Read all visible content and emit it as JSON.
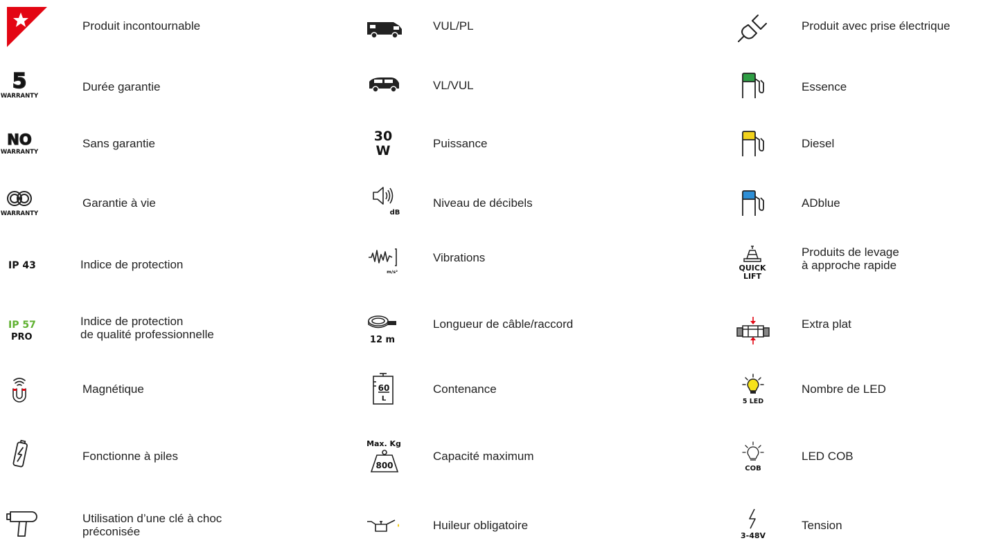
{
  "legend": {
    "col1": [
      {
        "icon": "star-flag-icon",
        "lines": [
          "Produit incontournable"
        ]
      },
      {
        "icon": "warranty-5-icon",
        "lines": [
          "Durée garantie"
        ],
        "badge": "5",
        "badge_sub": "WARRANTY"
      },
      {
        "icon": "no-warranty-icon",
        "lines": [
          "Sans garantie"
        ],
        "badge": "NO",
        "badge_sub": "WARRANTY"
      },
      {
        "icon": "lifetime-warranty-icon",
        "lines": [
          "Garantie à vie"
        ],
        "badge_sub": "WARRANTY"
      },
      {
        "icon": "ip43-icon",
        "lines": [
          "Indice de protection"
        ],
        "badge": "IP 43"
      },
      {
        "icon": "ip57-pro-icon",
        "lines": [
          "Indice de protection",
          "de qualité professionnelle"
        ],
        "badge": "IP 57",
        "badge_sub": "PRO"
      },
      {
        "icon": "magnet-icon",
        "lines": [
          "Magnétique"
        ]
      },
      {
        "icon": "battery-icon",
        "lines": [
          "Fonctionne à piles"
        ]
      },
      {
        "icon": "impact-wrench-icon",
        "lines": [
          "Utilisation d’une clé à choc",
          "préconisée"
        ]
      }
    ],
    "col2": [
      {
        "icon": "truck-icon",
        "lines": [
          "VUL/PL"
        ]
      },
      {
        "icon": "van-icon",
        "lines": [
          "VL/VUL"
        ]
      },
      {
        "icon": "power-icon",
        "lines": [
          "Puissance"
        ],
        "badge": "30",
        "badge_sub": "W"
      },
      {
        "icon": "speaker-icon",
        "lines": [
          "Niveau de décibels"
        ],
        "badge_sub": "dB"
      },
      {
        "icon": "vibration-icon",
        "lines": [
          "Vibrations"
        ],
        "badge_sub": "m/s²"
      },
      {
        "icon": "cable-reel-icon",
        "lines": [
          "Longueur de câble/raccord"
        ],
        "badge_sub": "12 m"
      },
      {
        "icon": "tank-icon",
        "lines": [
          "Contenance"
        ],
        "badge": "60",
        "badge_sub": "L"
      },
      {
        "icon": "weight-icon",
        "lines": [
          "Capacité maximum"
        ],
        "badge": "Max. Kg",
        "badge_sub": "800"
      },
      {
        "icon": "oil-can-icon",
        "lines": [
          "Huileur obligatoire"
        ]
      }
    ],
    "col3": [
      {
        "icon": "plug-icon",
        "lines": [
          "Produit avec prise électrique"
        ]
      },
      {
        "icon": "fuel-petrol-icon",
        "lines": [
          "Essence"
        ]
      },
      {
        "icon": "fuel-diesel-icon",
        "lines": [
          "Diesel"
        ]
      },
      {
        "icon": "fuel-adblue-icon",
        "lines": [
          "ADblue"
        ]
      },
      {
        "icon": "quick-lift-icon",
        "lines": [
          "Produits de levage",
          "à approche rapide"
        ],
        "badge": "QUICK",
        "badge_sub": "LIFT"
      },
      {
        "icon": "extra-flat-icon",
        "lines": [
          "Extra plat"
        ]
      },
      {
        "icon": "led-bulb-icon",
        "lines": [
          "Nombre de LED"
        ],
        "badge_sub": "5 LED"
      },
      {
        "icon": "cob-bulb-icon",
        "lines": [
          "LED COB"
        ],
        "badge_sub": "COB"
      },
      {
        "icon": "voltage-icon",
        "lines": [
          "Tension"
        ],
        "badge_sub": "3-48V"
      }
    ]
  },
  "colors": {
    "brand_red": "#e30613",
    "ip57_green": "#5fb130",
    "petrol_green": "#2e9e44",
    "diesel_yellow": "#f2d21b",
    "adblue_blue": "#2f8fd6",
    "bulb_yellow": "#f6e21a",
    "oil_drop_yellow": "#f2c500"
  }
}
